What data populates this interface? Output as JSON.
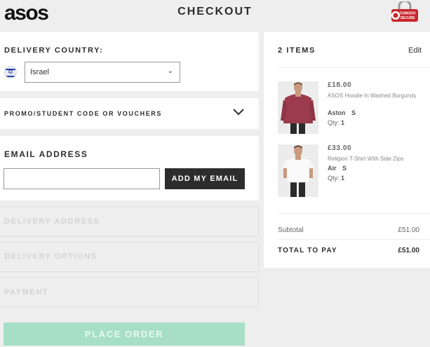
{
  "header": {
    "logo": "asos",
    "title": "CHECKOUT",
    "badge_text_1": "COMODO",
    "badge_text_2": "SECURE"
  },
  "delivery_country": {
    "label": "DELIVERY COUNTRY:",
    "selected": "Israel"
  },
  "promo": {
    "label": "PROMO/STUDENT CODE OR VOUCHERS"
  },
  "email": {
    "label": "EMAIL ADDRESS",
    "value": "",
    "button": "ADD MY EMAIL"
  },
  "sections": {
    "delivery_address": "DELIVERY ADDRESS",
    "delivery_options": "DELIVERY OPTIONS",
    "payment": "PAYMENT"
  },
  "place_order": "PLACE ORDER",
  "summary": {
    "items_title": "2 ITEMS",
    "edit": "Edit",
    "items": [
      {
        "price": "£18.00",
        "name": "ASOS Hoodie In Washed Burgundy",
        "colour": "Aston",
        "size": "S",
        "qty_label": "Qty:",
        "qty": "1"
      },
      {
        "price": "£33.00",
        "name": "Religion T-Shirt With Side Zips",
        "colour": "Air",
        "size": "S",
        "qty_label": "Qty:",
        "qty": "1"
      }
    ],
    "subtotal_label": "Subtotal",
    "subtotal": "£51.00",
    "total_label": "TOTAL TO PAY",
    "total": "£51.00"
  },
  "colors": {
    "background": "#eeeeee",
    "dark_button": "#2d2d2d",
    "place_order_button": "#a6dfc6",
    "badge_red": "#c8262c"
  }
}
